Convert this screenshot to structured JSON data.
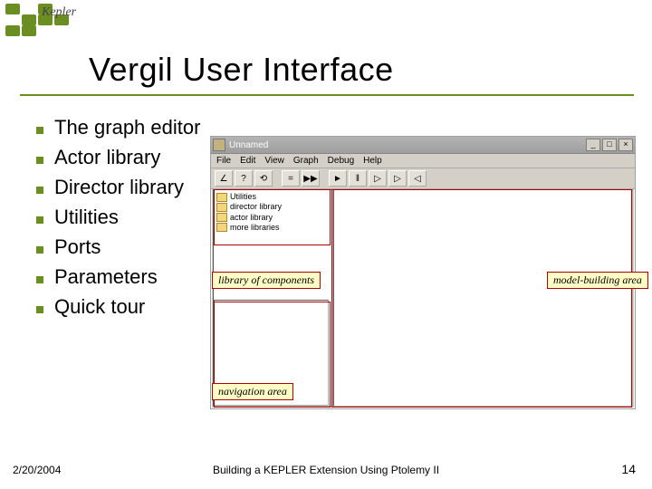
{
  "logo": {
    "label": "Kepler"
  },
  "slide": {
    "title": "Vergil User Interface",
    "bullets": [
      "The graph editor",
      "Actor library",
      "Director library",
      "Utilities",
      "Ports",
      "Parameters",
      "Quick tour"
    ]
  },
  "vergil": {
    "title": "Unnamed",
    "menus": [
      "File",
      "Edit",
      "View",
      "Graph",
      "Debug",
      "Help"
    ],
    "toolbar_glyphs": [
      "∠",
      "?",
      "⟲",
      "=",
      "▶▶",
      "►",
      "‖",
      "▷",
      "▷",
      "◁"
    ],
    "tree": [
      "Utilities",
      "director library",
      "actor library",
      "more libraries"
    ],
    "win_btns": [
      "_",
      "□",
      "×"
    ]
  },
  "callouts": {
    "lib": "library of components",
    "nav": "navigation area",
    "canvas": "model-building area"
  },
  "footer": {
    "date": "2/20/2004",
    "center": "Building a KEPLER Extension Using Ptolemy II",
    "page": "14"
  }
}
